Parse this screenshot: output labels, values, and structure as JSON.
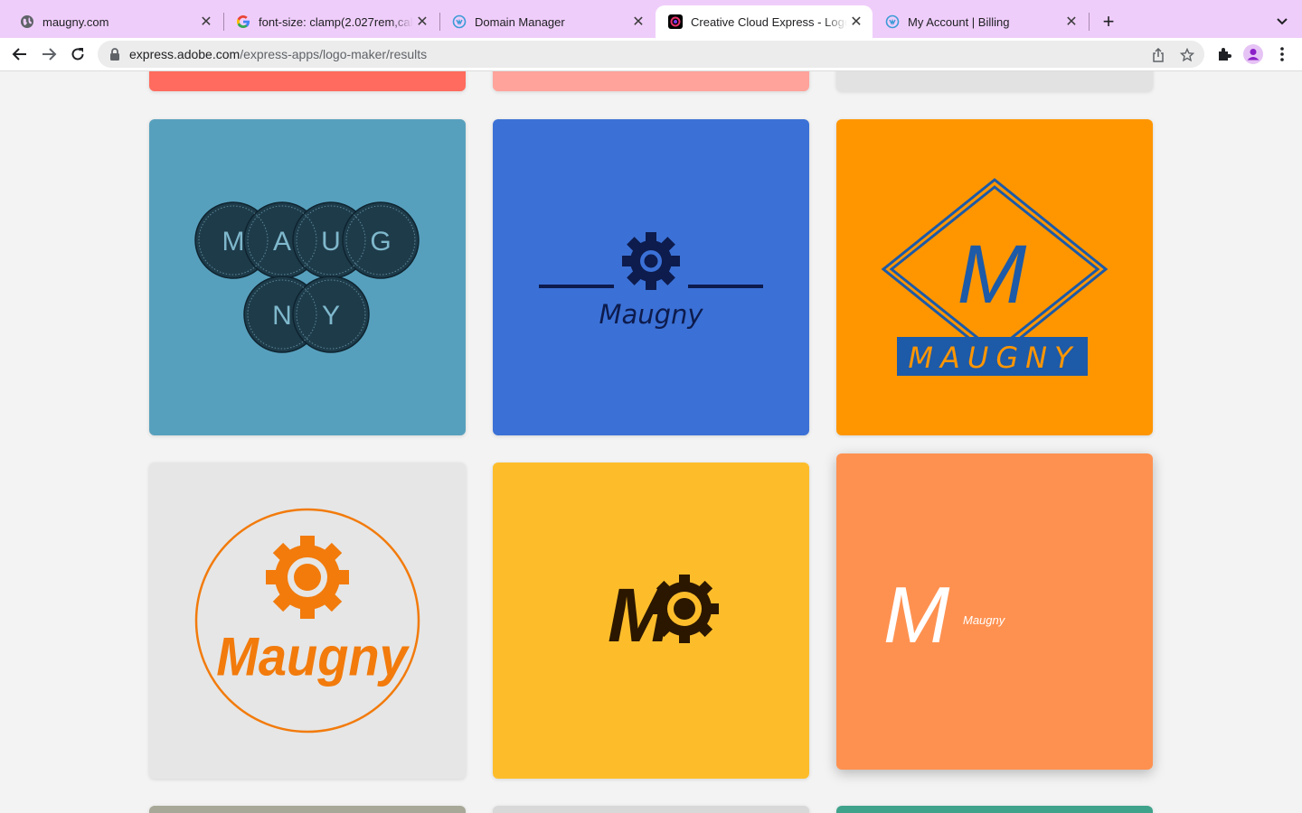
{
  "browser": {
    "tabs": [
      {
        "title": "maugny.com",
        "favicon": "globe-icon"
      },
      {
        "title": "font-size: clamp(2.027rem,calc",
        "favicon": "google-icon"
      },
      {
        "title": "Domain Manager",
        "favicon": "webflow-icon"
      },
      {
        "title": "Creative Cloud Express - Logo",
        "favicon": "adobe-express-icon"
      },
      {
        "title": "My Account | Billing",
        "favicon": "webflow-icon"
      }
    ],
    "active_tab_index": 3,
    "url_host": "express.adobe.com",
    "url_path": "/express-apps/logo-maker/results"
  },
  "colors": {
    "tabstrip": "#efcdfa",
    "card_teal": "#57a0bd",
    "card_blue": "#3b71d6",
    "card_orange": "#ff9600",
    "card_gray": "#e6e6e6",
    "card_yellow": "#fdbd2b",
    "card_salmon": "#ff9150",
    "top_red": "#ff6b5e",
    "top_pink": "#ffa39b",
    "top_gray": "#e2e2e2",
    "bottom_olive": "#a8a898",
    "bottom_lightgray": "#d8d8d8",
    "bottom_green": "#3fa28a"
  },
  "logos": {
    "circles": {
      "row1": [
        "M",
        "A",
        "U",
        "G"
      ],
      "row2": [
        "N",
        "Y"
      ]
    },
    "gear_line": {
      "name": "Maugny"
    },
    "diamond": {
      "letter": "M",
      "name": "MAUGNY"
    },
    "gear_circle": {
      "name": "Maugny"
    },
    "mo_gear": {
      "letter": "M"
    },
    "salmon": {
      "letter": "M",
      "name": "Maugny"
    }
  }
}
